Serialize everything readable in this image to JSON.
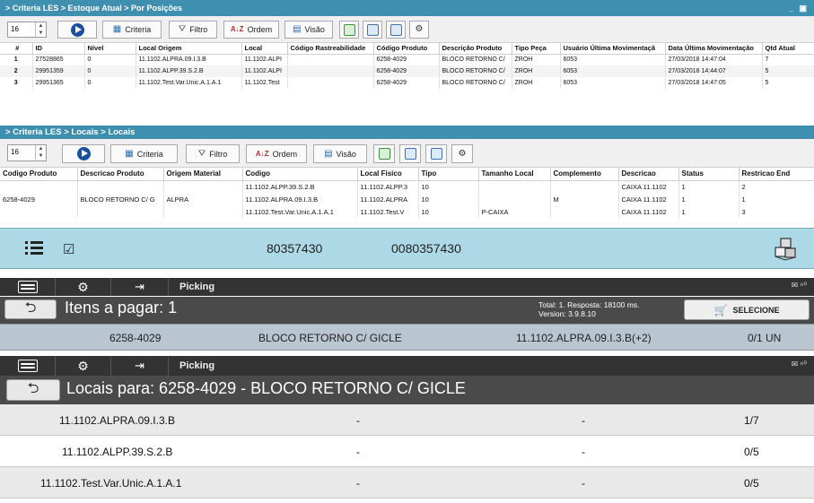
{
  "panel1": {
    "breadcrumb": "> Criteria LES > Estoque Atual > Por Posições",
    "window_controls": "_ ▣",
    "page_size": "16",
    "toolbar": {
      "criteria": "Criteria",
      "filtro": "Filtro",
      "ordem": "Ordem",
      "visao": "Visão"
    },
    "columns": [
      "#",
      "ID",
      "Nível",
      "Local Origem",
      "Local",
      "Código Rastreabilidade",
      "Código Produto",
      "Descrição Produto",
      "Tipo Peça",
      "Usuário Última Movimentaçã",
      "Data Última Movimentação",
      "Qtd Atual"
    ],
    "rows": [
      [
        "1",
        "27528865",
        "0",
        "11.1102.ALPRA.09.I.3.B",
        "11.1102.ALPI",
        "",
        "6258-4029",
        "BLOCO RETORNO C/",
        "ZROH",
        "6053",
        "27/03/2018 14:47:04",
        "7"
      ],
      [
        "2",
        "29951359",
        "0",
        "11.1102.ALPP.39.S.2.B",
        "11.1102.ALPI",
        "",
        "6258-4029",
        "BLOCO RETORNO C/",
        "ZROH",
        "6053",
        "27/03/2018 14:44:07",
        "5"
      ],
      [
        "3",
        "29951365",
        "0",
        "11.1102.Test.Var.Unic.A.1.A.1",
        "11.1102.Test",
        "",
        "6258-4029",
        "BLOCO RETORNO C/",
        "ZROH",
        "6053",
        "27/03/2018 14:47:05",
        "5"
      ]
    ]
  },
  "panel2": {
    "breadcrumb": "> Criteria LES > Locais > Locais",
    "page_size": "16",
    "toolbar": {
      "criteria": "Criteria",
      "filtro": "Filtro",
      "ordem": "Ordem",
      "visao": "Visão"
    },
    "columns": [
      "Codigo Produto",
      "Descricao Produto",
      "Origem Material",
      "Codigo",
      "Local Fisico",
      "Tipo",
      "Tamanho Local",
      "Complemento",
      "Descricao",
      "Status",
      "Restricao End"
    ],
    "rows": [
      [
        "",
        "",
        "",
        "11.1102.ALPP.39.S.2.B",
        "11.1102.ALPP.3",
        "10",
        "",
        "",
        "CAIXA 11.1102",
        "1",
        "2"
      ],
      [
        "6258-4029",
        "BLOCO RETORNO C/ G",
        "ALPRA",
        "11.1102.ALPRA.09.I.3.B",
        "11.1102.ALPRA",
        "10",
        "",
        "M",
        "CAIXA 11.1102",
        "1",
        "1"
      ],
      [
        "",
        "",
        "",
        "11.1102.Test.Var.Unic.A.1.A.1",
        "11.1102.Test.V",
        "10",
        "P-CAIXA",
        "",
        "CAIXA 11.1102",
        "1",
        "3"
      ]
    ]
  },
  "infobar": {
    "code1": "80357430",
    "code2": "0080357430"
  },
  "mobile1": {
    "title": "Picking",
    "header": "Itens a pagar: 1",
    "total_line": "Total: 1. Resposta: 18100 ms.",
    "version_line": "Version: 3.9.8.10",
    "select_label": "SELECIONE",
    "item": {
      "code": "6258-4029",
      "desc": "BLOCO RETORNO C/ GICLE",
      "location": "11.1102.ALPRA.09.I.3.B(+2)",
      "qty": "0/1 UN"
    }
  },
  "mobile2": {
    "title": "Picking",
    "header": "Locais para: 6258-4029 - BLOCO RETORNO C/ GICLE",
    "locations": [
      {
        "code": "11.1102.ALPRA.09.I.3.B",
        "a": "-",
        "b": "-",
        "qty": "1/7"
      },
      {
        "code": "11.1102.ALPP.39.S.2.B",
        "a": "-",
        "b": "-",
        "qty": "0/5"
      },
      {
        "code": "11.1102.Test.Var.Unic.A.1.A.1",
        "a": "-",
        "b": "-",
        "qty": "0/5"
      }
    ]
  },
  "icons": [
    "arrow-up-down-icon",
    "play-icon",
    "criteria-icon",
    "filter-icon",
    "sort-az-icon",
    "view-icon",
    "excel-icon",
    "save-icon",
    "refresh-icon",
    "tools-icon",
    "list-icon",
    "checkbox-icon",
    "boxes-icon",
    "menu-icon",
    "gear-icon",
    "exit-icon",
    "envelope-icon",
    "back-icon",
    "cart-icon"
  ]
}
